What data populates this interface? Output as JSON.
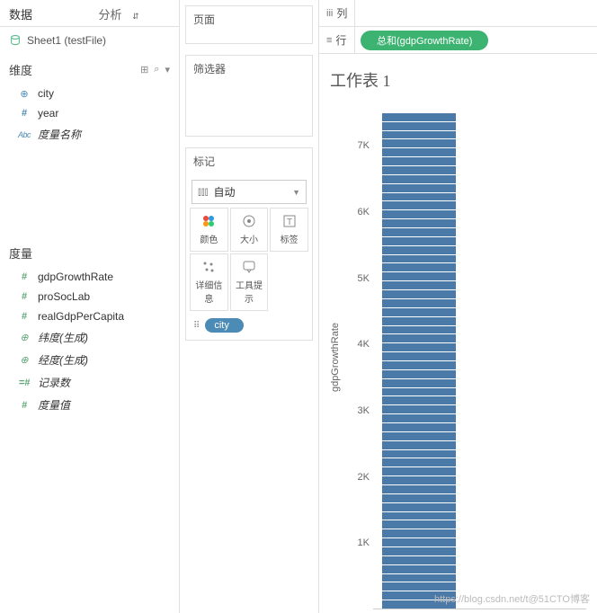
{
  "tabs": {
    "data": "数据",
    "analysis": "分析"
  },
  "datasource": {
    "name": "Sheet1 (testFile)"
  },
  "dimensions": {
    "title": "维度",
    "items": [
      {
        "icon": "globe",
        "label": "city"
      },
      {
        "icon": "hash",
        "label": "year"
      },
      {
        "icon": "abc",
        "label": "度量名称",
        "italic": true
      }
    ]
  },
  "measures": {
    "title": "度量",
    "items": [
      {
        "icon": "hashm",
        "label": "gdpGrowthRate"
      },
      {
        "icon": "hashm",
        "label": "proSocLab"
      },
      {
        "icon": "hashm",
        "label": "realGdpPerCapita"
      },
      {
        "icon": "globe-m",
        "label": "纬度(生成)",
        "italic": true
      },
      {
        "icon": "globe-m",
        "label": "经度(生成)",
        "italic": true
      },
      {
        "icon": "equal",
        "label": "记录数",
        "italic": true
      },
      {
        "icon": "hashm",
        "label": "度量值",
        "italic": true
      }
    ]
  },
  "pages": {
    "title": "页面"
  },
  "filters": {
    "title": "筛选器"
  },
  "marks": {
    "title": "标记",
    "type": "自动",
    "buttons": {
      "color": "颜色",
      "size": "大小",
      "label": "标签",
      "detail": "详细信息",
      "tooltip": "工具提示"
    },
    "colorPill": "city"
  },
  "shelves": {
    "columns": {
      "label": "列"
    },
    "rows": {
      "label": "行",
      "pill": "总和(gdpGrowthRate)"
    }
  },
  "viz": {
    "title": "工作表 1",
    "yAxisLabel": "gdpGrowthRate",
    "ticks": [
      "1K",
      "2K",
      "3K",
      "4K",
      "5K",
      "6K",
      "7K"
    ]
  },
  "chart_data": {
    "type": "bar",
    "title": "工作表 1",
    "xlabel": "",
    "ylabel": "gdpGrowthRate",
    "ylim": [
      0,
      7600
    ],
    "categories": [
      ""
    ],
    "note": "single stacked bar; total SUM(gdpGrowthRate) ≈ 7500, stacked by city (many segments, individual city values not labeled)",
    "series": [
      {
        "name": "总和(gdpGrowthRate)",
        "values": [
          7500
        ]
      }
    ],
    "stack_by": "city",
    "approx_segment_count": 56
  },
  "watermark": "https://blog.csdn.net/t@51CTO博客"
}
